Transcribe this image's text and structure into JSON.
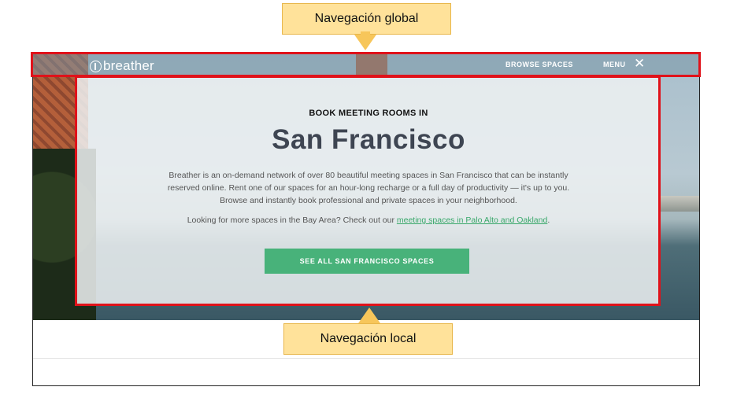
{
  "callouts": {
    "global": "Navegación global",
    "local": "Navegación local"
  },
  "site": {
    "logo_text": "breather",
    "nav": {
      "browse": "BROWSE SPACES",
      "menu": "MENU",
      "close_glyph": "✕"
    },
    "panel": {
      "kicker": "BOOK MEETING ROOMS IN",
      "title": "San Francisco",
      "description": "Breather is an on-demand network of over 80 beautiful meeting spaces in San Francisco that can be instantly reserved online. Rent one of our spaces for an hour-long recharge or a full day of productivity — it's up to you. Browse and instantly book professional and private spaces in your neighborhood.",
      "more_prefix": "Looking for more spaces in the Bay Area? Check out our ",
      "more_link": "meeting spaces in Palo Alto and Oakland",
      "more_suffix": ".",
      "cta": "SEE ALL SAN FRANCISCO SPACES"
    }
  },
  "colors": {
    "highlight": "#e0121a",
    "callout_bg": "#ffe29a",
    "cta_bg": "#48b27a",
    "link": "#3aa86b",
    "title": "#3e4552"
  },
  "icons": {
    "logo": "breather-logo-icon",
    "close": "close-icon"
  }
}
